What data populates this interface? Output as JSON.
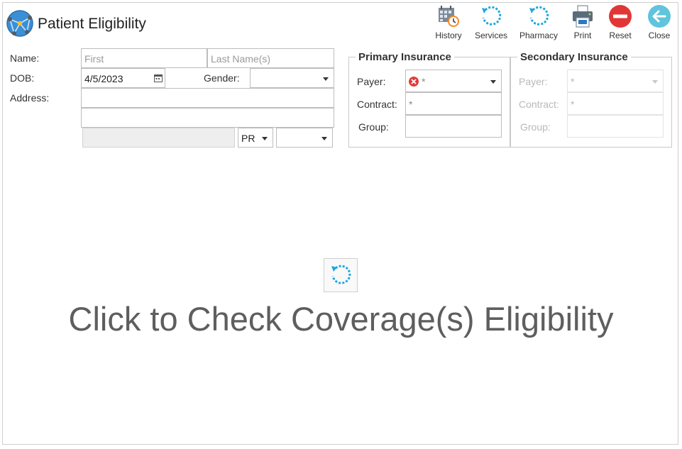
{
  "window": {
    "title": "Patient Eligibility"
  },
  "toolbar": [
    {
      "key": "history",
      "label": "History",
      "icon": "calendar-clock-icon"
    },
    {
      "key": "services",
      "label": "Services",
      "icon": "refresh-icon"
    },
    {
      "key": "pharmacy",
      "label": "Pharmacy",
      "icon": "refresh-icon"
    },
    {
      "key": "print",
      "label": "Print",
      "icon": "printer-icon"
    },
    {
      "key": "reset",
      "label": "Reset",
      "icon": "minus-circle-icon"
    },
    {
      "key": "close",
      "label": "Close",
      "icon": "arrow-left-circle-icon"
    }
  ],
  "form": {
    "name_label": "Name:",
    "first_placeholder": "First",
    "last_placeholder": "Last Name(s)",
    "dob_label": "DOB:",
    "dob_value": "4/5/2023",
    "gender_label": "Gender:",
    "gender_value": "",
    "address_label": "Address:",
    "address_line1": "",
    "address_line2": "",
    "city": "",
    "state_value": "PR",
    "zip_value": ""
  },
  "primary_insurance": {
    "title": "Primary Insurance",
    "payer_label": "Payer:",
    "payer_value": "*",
    "contract_label": "Contract:",
    "contract_value": "*",
    "group_label": "Group:",
    "group_value": ""
  },
  "secondary_insurance": {
    "title": "Secondary Insurance",
    "payer_label": "Payer:",
    "payer_value": "*",
    "contract_label": "Contract:",
    "contract_value": "*",
    "group_label": "Group:",
    "group_value": ""
  },
  "main": {
    "check_text": "Click to Check Coverage(s) Eligibility"
  },
  "colors": {
    "accent_blue": "#1ea6e0",
    "reset_red": "#e23636",
    "close_teal": "#5fc4dc",
    "error_red": "#e03c3c"
  }
}
